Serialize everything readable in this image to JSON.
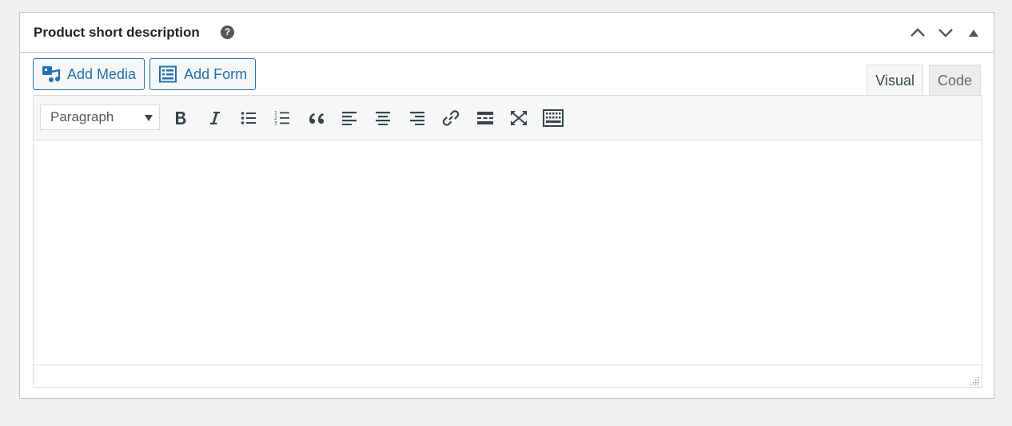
{
  "box": {
    "title": "Product short description",
    "help_icon": "help-icon",
    "help_glyph": "?"
  },
  "handle_actions": [
    "move-up-icon",
    "move-down-icon",
    "toggle-panel-icon"
  ],
  "media_buttons": {
    "add_media": {
      "label": "Add Media",
      "icon": "media-icon"
    },
    "add_form": {
      "label": "Add Form",
      "icon": "form-icon"
    }
  },
  "tabs": {
    "visual": "Visual",
    "code": "Code",
    "active": "visual"
  },
  "toolbar": {
    "format_select": {
      "value": "Paragraph"
    },
    "buttons": [
      "bold-icon",
      "italic-icon",
      "bullet-list-icon",
      "numbered-list-icon",
      "blockquote-icon",
      "align-left-icon",
      "align-center-icon",
      "align-right-icon",
      "link-icon",
      "read-more-icon",
      "fullscreen-icon",
      "toolbar-toggle-icon"
    ]
  },
  "colors": {
    "accent": "#2271b1",
    "icon": "#3c434a",
    "border": "#dcdcde"
  },
  "editor": {
    "content": ""
  }
}
